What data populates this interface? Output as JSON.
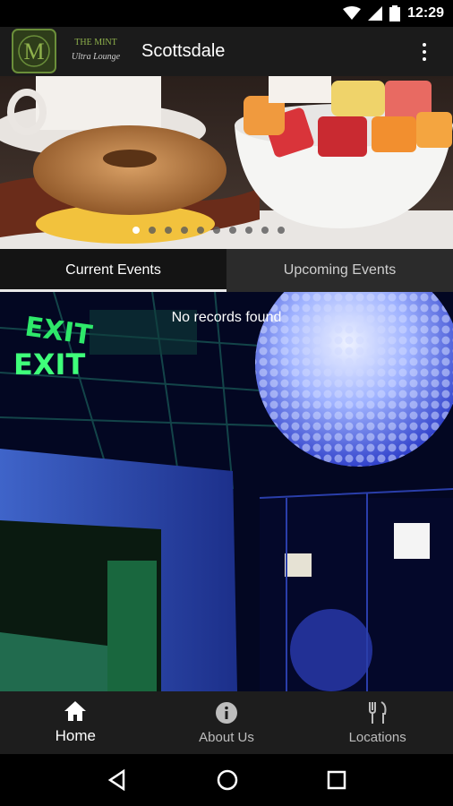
{
  "status_bar": {
    "time": "12:29"
  },
  "app_bar": {
    "logo_text_line1": "THE MINT",
    "logo_text_line2": "Ultra Lounge",
    "logo_monogram": "M",
    "title": "Scottsdale",
    "overflow_icon": "more-vert-icon"
  },
  "carousel": {
    "slide_count": 10,
    "active_index": 0
  },
  "tabs": [
    {
      "label": "Current Events",
      "active": true
    },
    {
      "label": "Upcoming Events",
      "active": false
    }
  ],
  "content": {
    "empty_message": "No records found"
  },
  "bottom_nav": [
    {
      "label": "Home",
      "icon": "home-icon",
      "active": true
    },
    {
      "label": "About Us",
      "icon": "info-icon",
      "active": false
    },
    {
      "label": "Locations",
      "icon": "utensils-icon",
      "active": false
    }
  ],
  "system_nav": {
    "back": "back-icon",
    "home": "home-circle-icon",
    "recents": "recents-icon"
  },
  "colors": {
    "accent_green": "#6b8f3a",
    "app_bar": "#1b1b1b",
    "tab_bar": "#141414"
  }
}
